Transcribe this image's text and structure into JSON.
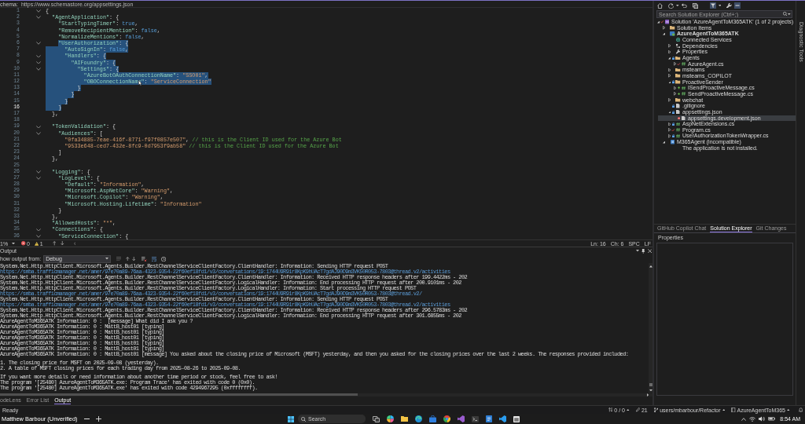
{
  "schema_bar": {
    "label": "chema:",
    "url": "https://www.schemastore.org/appsettings.json"
  },
  "editor": {
    "lines": [
      {
        "number": "1",
        "fold": true,
        "current": false,
        "selected": false,
        "tokens": [
          {
            "kind": "punct",
            "text": "{"
          }
        ]
      },
      {
        "number": "2",
        "fold": true,
        "current": false,
        "selected": false,
        "indent_selected": false,
        "tokens": [
          {
            "kind": "key",
            "text": "  \"AgentApplication\""
          },
          {
            "kind": "punct",
            "text": ": {"
          }
        ]
      },
      {
        "number": "3",
        "fold": false,
        "current": false,
        "selected": false,
        "indent_selected": false,
        "tokens": [
          {
            "kind": "key",
            "text": "    \"StartTypingTimer\""
          },
          {
            "kind": "punct",
            "text": ": "
          },
          {
            "kind": "literal",
            "text": "true"
          },
          {
            "kind": "punct",
            "text": ","
          }
        ]
      },
      {
        "number": "4",
        "fold": false,
        "current": false,
        "selected": false,
        "indent_selected": false,
        "tokens": [
          {
            "kind": "key",
            "text": "    \"RemoveRecipientMention\""
          },
          {
            "kind": "punct",
            "text": ": "
          },
          {
            "kind": "literal",
            "text": "false"
          },
          {
            "kind": "punct",
            "text": ","
          }
        ]
      },
      {
        "number": "5",
        "fold": false,
        "current": false,
        "selected": false,
        "indent_selected": false,
        "tokens": [
          {
            "kind": "key",
            "text": "    \"NormalizeMentions\""
          },
          {
            "kind": "punct",
            "text": ": "
          },
          {
            "kind": "literal",
            "text": "false"
          },
          {
            "kind": "punct",
            "text": ","
          }
        ]
      },
      {
        "number": "6",
        "fold": true,
        "current": false,
        "selected": true,
        "indent_selected": false,
        "tokens": [
          {
            "kind": "key",
            "text": "    \"UserAuthorization\""
          },
          {
            "kind": "punct",
            "text": ": {"
          }
        ]
      },
      {
        "number": "7",
        "fold": false,
        "current": false,
        "selected": true,
        "indent_selected": true,
        "tokens": [
          {
            "kind": "key",
            "text": "      \"AutoSignIn\""
          },
          {
            "kind": "punct",
            "text": ": "
          },
          {
            "kind": "literal",
            "text": "false"
          },
          {
            "kind": "punct",
            "text": ","
          }
        ]
      },
      {
        "number": "8",
        "fold": true,
        "current": false,
        "selected": true,
        "indent_selected": true,
        "tokens": [
          {
            "kind": "key",
            "text": "      \"Handlers\""
          },
          {
            "kind": "punct",
            "text": ": {"
          }
        ]
      },
      {
        "number": "9",
        "fold": true,
        "current": false,
        "selected": true,
        "indent_selected": true,
        "tokens": [
          {
            "kind": "key",
            "text": "        \"AIFoundry\""
          },
          {
            "kind": "punct",
            "text": ": {"
          }
        ]
      },
      {
        "number": "10",
        "fold": true,
        "current": false,
        "selected": true,
        "indent_selected": true,
        "tokens": [
          {
            "kind": "key",
            "text": "          \"Settings\""
          },
          {
            "kind": "punct",
            "text": ": {"
          }
        ]
      },
      {
        "number": "11",
        "fold": false,
        "current": false,
        "selected": true,
        "indent_selected": true,
        "tokens": [
          {
            "kind": "key",
            "text": "            \"AzureBotOAuthConnectionName\""
          },
          {
            "kind": "punct",
            "text": ": "
          },
          {
            "kind": "string",
            "text": "\"SSO01\""
          },
          {
            "kind": "punct",
            "text": ","
          }
        ]
      },
      {
        "number": "12",
        "fold": false,
        "current": false,
        "selected": true,
        "indent_selected": true,
        "tokens": [
          {
            "kind": "key",
            "text": "            \"OBOConnectionName\""
          },
          {
            "kind": "punct",
            "text": ": "
          },
          {
            "kind": "string",
            "text": "\"ServiceConnection\""
          }
        ]
      },
      {
        "number": "13",
        "fold": false,
        "current": false,
        "selected": true,
        "indent_selected": true,
        "tokens": [
          {
            "kind": "punct",
            "text": "          }"
          }
        ]
      },
      {
        "number": "14",
        "fold": false,
        "current": false,
        "selected": true,
        "indent_selected": true,
        "tokens": [
          {
            "kind": "punct",
            "text": "        }"
          }
        ]
      },
      {
        "number": "15",
        "fold": false,
        "current": false,
        "selected": true,
        "indent_selected": true,
        "tokens": [
          {
            "kind": "punct",
            "text": "      }"
          }
        ]
      },
      {
        "number": "16",
        "fold": false,
        "current": true,
        "selected": true,
        "indent_selected": true,
        "tokens": [
          {
            "kind": "punct",
            "text": "    }"
          }
        ]
      },
      {
        "number": "17",
        "fold": false,
        "current": false,
        "selected": false,
        "indent_selected": false,
        "tokens": [
          {
            "kind": "punct",
            "text": "  },"
          }
        ]
      },
      {
        "number": "18",
        "fold": false,
        "current": false,
        "selected": false
      },
      {
        "number": "19",
        "fold": true,
        "current": false,
        "selected": false,
        "indent_selected": false,
        "tokens": [
          {
            "kind": "key",
            "text": "  \"TokenValidation\""
          },
          {
            "kind": "punct",
            "text": ": {"
          }
        ]
      },
      {
        "number": "20",
        "fold": true,
        "current": false,
        "selected": false,
        "indent_selected": false,
        "tokens": [
          {
            "kind": "key",
            "text": "    \"Audiences\""
          },
          {
            "kind": "punct",
            "text": ": ["
          }
        ]
      },
      {
        "number": "21",
        "fold": false,
        "current": false,
        "selected": false,
        "indent_selected": false,
        "tokens": [
          {
            "kind": "string",
            "text": "      \"0fa34885-7eae-416f-8771-f97f0857e507\""
          },
          {
            "kind": "punct",
            "text": ","
          },
          {
            "kind": "comment",
            "text": " // this is the Client ID used for the Azure Bot"
          }
        ]
      },
      {
        "number": "22",
        "fold": false,
        "current": false,
        "selected": false,
        "indent_selected": false,
        "tokens": [
          {
            "kind": "string",
            "text": "      \"9533e648-ced7-432e-8fc9-0d7953f9ab58\""
          },
          {
            "kind": "comment",
            "text": " // this is the Client ID used for the Azure Bot"
          }
        ]
      },
      {
        "number": "23",
        "fold": false,
        "current": false,
        "selected": false,
        "indent_selected": false,
        "tokens": [
          {
            "kind": "punct",
            "text": "    ]"
          }
        ]
      },
      {
        "number": "24",
        "fold": false,
        "current": false,
        "selected": false,
        "indent_selected": false,
        "tokens": [
          {
            "kind": "punct",
            "text": "  },"
          }
        ]
      },
      {
        "number": "25",
        "fold": false,
        "current": false,
        "selected": false
      },
      {
        "number": "26",
        "fold": true,
        "current": false,
        "selected": false,
        "indent_selected": false,
        "tokens": [
          {
            "kind": "key",
            "text": "  \"Logging\""
          },
          {
            "kind": "punct",
            "text": ": {"
          }
        ]
      },
      {
        "number": "27",
        "fold": true,
        "current": false,
        "selected": false,
        "indent_selected": false,
        "tokens": [
          {
            "kind": "key",
            "text": "    \"LogLevel\""
          },
          {
            "kind": "punct",
            "text": ": {"
          }
        ]
      },
      {
        "number": "28",
        "fold": false,
        "current": false,
        "selected": false,
        "indent_selected": false,
        "tokens": [
          {
            "kind": "key",
            "text": "      \"Default\""
          },
          {
            "kind": "punct",
            "text": ": "
          },
          {
            "kind": "string",
            "text": "\"Information\""
          },
          {
            "kind": "punct",
            "text": ","
          }
        ]
      },
      {
        "number": "29",
        "fold": false,
        "current": false,
        "selected": false,
        "indent_selected": false,
        "tokens": [
          {
            "kind": "key",
            "text": "      \"Microsoft.AspNetCore\""
          },
          {
            "kind": "punct",
            "text": ": "
          },
          {
            "kind": "string",
            "text": "\"Warning\""
          },
          {
            "kind": "punct",
            "text": ","
          }
        ]
      },
      {
        "number": "30",
        "fold": false,
        "current": false,
        "selected": false,
        "indent_selected": false,
        "tokens": [
          {
            "kind": "key",
            "text": "      \"Microsoft.Copilot\""
          },
          {
            "kind": "punct",
            "text": ": "
          },
          {
            "kind": "string",
            "text": "\"Warning\""
          },
          {
            "kind": "punct",
            "text": ","
          }
        ]
      },
      {
        "number": "31",
        "fold": false,
        "current": false,
        "selected": false,
        "indent_selected": false,
        "tokens": [
          {
            "kind": "key",
            "text": "      \"Microsoft.Hosting.Lifetime\""
          },
          {
            "kind": "punct",
            "text": ": "
          },
          {
            "kind": "string",
            "text": "\"Information\""
          }
        ]
      },
      {
        "number": "32",
        "fold": false,
        "current": false,
        "selected": false,
        "indent_selected": false,
        "tokens": [
          {
            "kind": "punct",
            "text": "    }"
          }
        ]
      },
      {
        "number": "33",
        "fold": false,
        "current": false,
        "selected": false,
        "indent_selected": false,
        "tokens": [
          {
            "kind": "punct",
            "text": "  },"
          }
        ]
      },
      {
        "number": "34",
        "fold": false,
        "current": false,
        "selected": false,
        "indent_selected": false,
        "tokens": [
          {
            "kind": "key",
            "text": "  \"AllowedHosts\""
          },
          {
            "kind": "punct",
            "text": ": "
          },
          {
            "kind": "string",
            "text": "\"*\""
          },
          {
            "kind": "punct",
            "text": ","
          }
        ]
      },
      {
        "number": "35",
        "fold": true,
        "current": false,
        "selected": false,
        "indent_selected": false,
        "tokens": [
          {
            "kind": "key",
            "text": "  \"Connections\""
          },
          {
            "kind": "punct",
            "text": ": {"
          }
        ]
      },
      {
        "number": "36",
        "fold": true,
        "current": false,
        "selected": false,
        "indent_selected": false,
        "tokens": [
          {
            "kind": "key",
            "text": "    \"ServiceConnection\""
          },
          {
            "kind": "punct",
            "text": ": {"
          }
        ]
      }
    ]
  },
  "editor_status": {
    "zoom": "1%",
    "errors": "0",
    "warnings": "1",
    "line": "Ln: 16",
    "column": "Ch: 6",
    "indent": "SPC",
    "eol": "LF"
  },
  "output": {
    "title": "Output",
    "source_label": "how output from:",
    "source": "Debug",
    "paragraphs": [
      [
        {
          "text": "System.Net.Http.HttpClient.Microsoft.Agents.Builder.RestChannelServiceClientFactory.ClientHandler: Information: Sending HTTP request POST ",
          "url": "https://smba.trafficmanager.net/amer/97e70a89-76aa-4323-9354-22f60ef18fd1/v3/conversations/19:1744U9R91r8KpK9hUAcT7gdAJ90D9m3VK50R053-7803@thread.v2/activities"
        },
        {
          "text": "System.Net.Http.HttpClient.Microsoft.Agents.Builder.RestChannelServiceClientFactory.ClientHandler: Information: Received HTTP response headers after 199.4422ms - 202"
        },
        {
          "text": "System.Net.Http.HttpClient.Microsoft.Agents.Builder.RestChannelServiceClientFactory.LogicalHandler: Information: End processing HTTP request after 200.9101ms - 202"
        },
        {
          "text": "System.Net.Http.HttpClient.Microsoft.Agents.Builder.RestChannelServiceClientFactory.LogicalHandler: Information: Start processing HTTP request POST ",
          "url": "https://smba.trafficmanager.net/amer/97e70a89-76aa-4323-9354-22f60ef18fd1/v3/conversations/19:1744U9R91r8KpK9hUAcT7gdAJ90D9m3VK50R053-7803@thread.v2/"
        },
        {
          "text": "System.Net.Http.HttpClient.Microsoft.Agents.Builder.RestChannelServiceClientFactory.ClientHandler: Information: Sending HTTP request POST ",
          "url": "https://smba.trafficmanager.net/amer/97e70a89-76aa-4323-9354-22f60ef18fd1/v3/conversations/19:1744U9R91r8KpK9hUAcT7gdAJ90D9m3VK50R053-7803@thread.v2/activities"
        },
        {
          "text": "System.Net.Http.HttpClient.Microsoft.Agents.Builder.RestChannelServiceClientFactory.ClientHandler: Information: Received HTTP response headers after 296.5783ms - 202"
        },
        {
          "text": "System.Net.Http.HttpClient.Microsoft.Agents.Builder.RestChannelServiceClientFactory.LogicalHandler: Information: End processing HTTP request after 301.6855ms - 202"
        },
        {
          "text": "AzureAgentToM365ATK Information: 0 :  [message] What did I ask you ?"
        },
        {
          "text": "AzureAgentToM365ATK Information: 0 : MattB_host01 [typing]"
        },
        {
          "text": "AzureAgentToM365ATK Information: 0 : MattB_host01 [typing]"
        },
        {
          "text": "AzureAgentToM365ATK Information: 0 : MattB_host01 [typing]"
        },
        {
          "text": "AzureAgentToM365ATK Information: 0 : MattB_host01 [typing]"
        },
        {
          "text": "AzureAgentToM365ATK Information: 0 : MattB_host01 [typing]"
        },
        {
          "text": "AzureAgentToM365ATK Information: 0 : MattB_host01 [message] You asked about the closing price of Microsoft (MSFT) yesterday, and then you asked for the closing prices over the last 2 weeks. The responses provided included:"
        }
      ],
      [
        {
          "text": "1. The closing price for MSFT on 2025-09-08 (yesterday)."
        },
        {
          "text": "2. A table of MSFT closing prices for each trading day from 2025-08-26 to 2025-09-08."
        }
      ],
      [
        {
          "text": "If you want more details or need information about another time period or stock, feel free to ask!"
        },
        {
          "text": "The program '[25480] AzureAgentToM365ATK.exe: Program Trace' has exited with code 0 (0x0)."
        },
        {
          "text": "The program '[25480] AzureAgentToM365ATK.exe' has exited with code 4294967295 (0xffffffff)."
        }
      ]
    ]
  },
  "tool_tabs": [
    {
      "label": "odeLens",
      "selected": false
    },
    {
      "label": "Error List",
      "selected": false
    },
    {
      "label": "Output",
      "selected": true
    }
  ],
  "solution_explorer": {
    "search": {
      "placeholder": "Search Solution Explorer (Ctrl+;)"
    },
    "tree": [
      {
        "label": "Solution 'AzureAgentToM365ATK' (1 of 2 projects)",
        "kind": "solution",
        "expanded": true,
        "checked_in": false,
        "modified": true,
        "added": false,
        "ignored": false,
        "selected": false,
        "children": [
          {
            "label": "Solution Items",
            "kind": "folder",
            "expanded": false,
            "checked_in": false,
            "modified": false,
            "added": false,
            "ignored": false,
            "selected": false
          },
          {
            "label": "AzureAgentToM365ATK",
            "kind": "project",
            "expanded": true,
            "checked_in": false,
            "modified": false,
            "added": false,
            "ignored": false,
            "selected": false,
            "children": [
              {
                "label": "Connected Services",
                "kind": "services",
                "checked_in": false,
                "modified": false,
                "added": false,
                "ignored": false,
                "selected": false
              },
              {
                "label": "Dependencies",
                "kind": "dependencies",
                "expanded": false,
                "checked_in": false,
                "modified": false,
                "added": false,
                "ignored": false,
                "selected": false
              },
              {
                "label": "Properties",
                "kind": "properties",
                "expanded": false,
                "checked_in": false,
                "modified": false,
                "added": false,
                "ignored": false,
                "selected": false
              },
              {
                "label": "Agents",
                "kind": "folder",
                "expanded": true,
                "checked_in": true,
                "modified": false,
                "added": false,
                "ignored": false,
                "selected": false,
                "children": [
                  {
                    "label": "AzureAgent.cs",
                    "kind": "csharp",
                    "expanded": false,
                    "checked_in": false,
                    "modified": true,
                    "added": false,
                    "ignored": false,
                    "selected": false
                  }
                ]
              },
              {
                "label": "msteams",
                "kind": "folder",
                "expanded": false,
                "checked_in": false,
                "modified": false,
                "added": false,
                "ignored": false,
                "selected": false
              },
              {
                "label": "msteams_COPILOT",
                "kind": "folder",
                "expanded": false,
                "checked_in": false,
                "modified": false,
                "added": false,
                "ignored": false,
                "selected": false
              },
              {
                "label": "ProactiveSender",
                "kind": "folder",
                "expanded": true,
                "checked_in": true,
                "modified": false,
                "added": false,
                "ignored": false,
                "selected": false,
                "children": [
                  {
                    "label": "ISendProactiveMessage.cs",
                    "kind": "csharp",
                    "expanded": false,
                    "checked_in": false,
                    "modified": false,
                    "added": true,
                    "ignored": false,
                    "selected": false
                  },
                  {
                    "label": "SendProactiveMessage.cs",
                    "kind": "csharp",
                    "expanded": false,
                    "checked_in": false,
                    "modified": false,
                    "added": true,
                    "ignored": false,
                    "selected": false
                  }
                ]
              },
              {
                "label": "webchat",
                "kind": "folder",
                "expanded": false,
                "checked_in": false,
                "modified": false,
                "added": false,
                "ignored": false,
                "selected": false
              },
              {
                "label": ".gitignore",
                "kind": "file",
                "checked_in": true,
                "modified": false,
                "added": false,
                "ignored": false,
                "selected": false
              },
              {
                "label": "appsettings.json",
                "kind": "json",
                "expanded": true,
                "checked_in": true,
                "modified": false,
                "added": false,
                "ignored": false,
                "selected": false,
                "children": [
                  {
                    "label": "appsettings.development.json",
                    "kind": "json",
                    "checked_in": false,
                    "modified": false,
                    "added": false,
                    "ignored": true,
                    "selected": true
                  }
                ]
              },
              {
                "label": "AspNetExtensions.cs",
                "kind": "csharp",
                "expanded": false,
                "checked_in": true,
                "modified": false,
                "added": false,
                "ignored": false,
                "selected": false
              },
              {
                "label": "Program.cs",
                "kind": "csharp",
                "expanded": false,
                "checked_in": false,
                "modified": true,
                "added": false,
                "ignored": false,
                "selected": false
              },
              {
                "label": "UserAuthorizationTokenWrapper.cs",
                "kind": "csharp",
                "expanded": false,
                "checked_in": true,
                "modified": false,
                "added": false,
                "ignored": false,
                "selected": false
              }
            ]
          },
          {
            "label": "M365Agent (incompatible)",
            "kind": "package",
            "expanded": true,
            "checked_in": false,
            "modified": false,
            "added": false,
            "ignored": false,
            "selected": false,
            "children": [
              {
                "label": "The application is not installed.",
                "kind": "message",
                "checked_in": false,
                "modified": false,
                "added": false,
                "ignored": false,
                "selected": false
              }
            ]
          }
        ]
      }
    ]
  },
  "panel_tabs": [
    {
      "label": "GitHub Copilot Chat",
      "selected": false
    },
    {
      "label": "Solution Explorer",
      "selected": true
    },
    {
      "label": "Git Changes",
      "selected": false
    }
  ],
  "properties": {
    "title": "Properties"
  },
  "side_tabs": [
    {
      "label": "Diagnostic Tools"
    }
  ],
  "status_bar": {
    "text": "Ready",
    "changes": "0 / 0",
    "edits": "21",
    "branch": "users/mbarbour/Refactor",
    "repo": "AzureAgentToM365"
  },
  "taskbar": {
    "user": "Matthew Barbour (Unverified)",
    "search": {
      "placeholder": "Search"
    },
    "time": "8:54 AM"
  }
}
